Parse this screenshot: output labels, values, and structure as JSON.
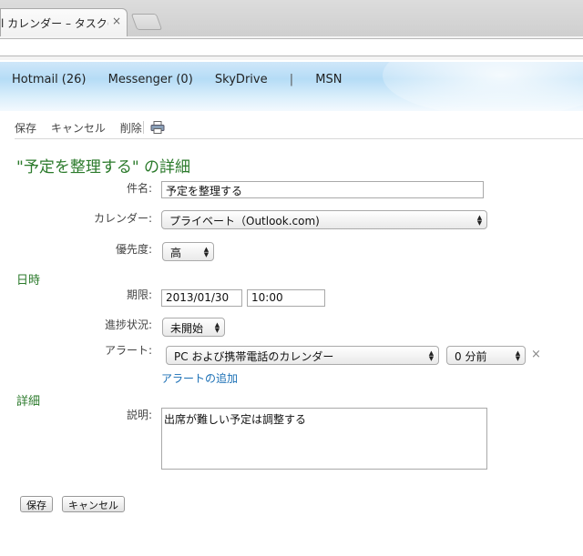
{
  "browser": {
    "tab_title": "l カレンダー – タスク(",
    "tab_close": "×"
  },
  "header": {
    "nav": [
      "Hotmail (26)",
      "Messenger (0)",
      "SkyDrive",
      "|",
      "MSN"
    ]
  },
  "toolbar": {
    "save": "保存",
    "cancel": "キャンセル",
    "delete": "削除",
    "print_icon": "printer-icon"
  },
  "page": {
    "title": "\"予定を整理する\" の詳細"
  },
  "form": {
    "subject_label": "件名:",
    "subject_value": "予定を整理する",
    "calendar_label": "カレンダー:",
    "calendar_value": "プライベート（Outlook.com)",
    "priority_label": "優先度:",
    "priority_value": "高",
    "datetime_section": "日時",
    "due_label": "期限:",
    "due_date": "2013/01/30",
    "due_time": "10:00",
    "status_label": "進捗状況:",
    "status_value": "未開始",
    "alert_label": "アラート:",
    "alert_target": "PC および携帯電話のカレンダー",
    "alert_offset": "0 分前",
    "alert_remove": "×",
    "add_alert": "アラートの追加",
    "details_section": "詳細",
    "desc_label": "説明:",
    "desc_value": "出席が難しい予定は調整する"
  },
  "buttons": {
    "save": "保存",
    "cancel": "キャンセル"
  }
}
